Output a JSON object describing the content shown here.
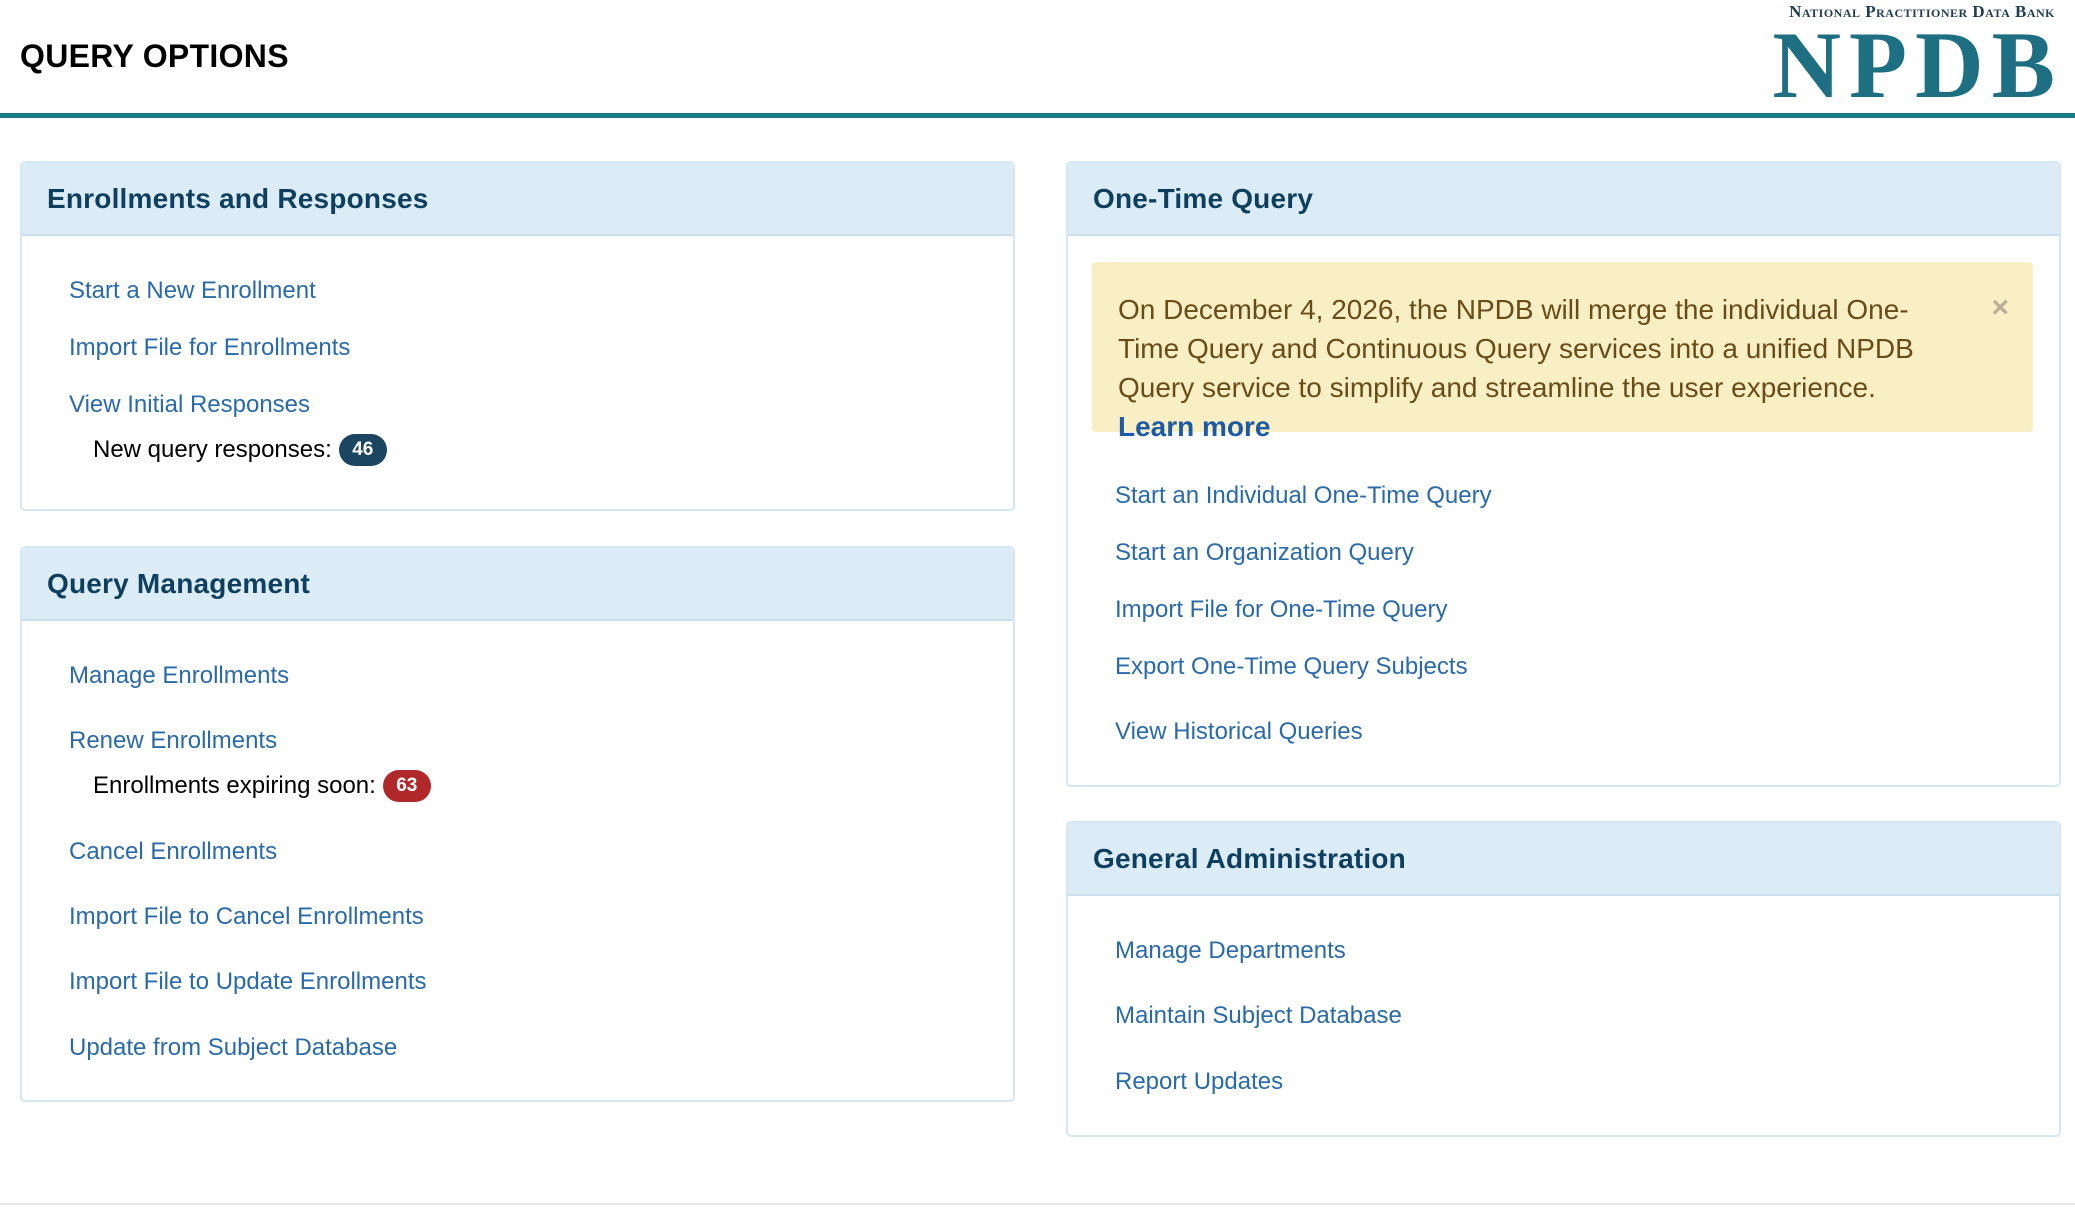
{
  "header": {
    "title": "QUERY OPTIONS",
    "logo_small": "National Practitioner Data Bank",
    "logo_big": "NPDB"
  },
  "enrollments": {
    "title": "Enrollments and Responses",
    "links": [
      "Start a New Enrollment",
      "Import File for Enrollments",
      "View Initial Responses"
    ],
    "new_responses_label": "New query responses:",
    "new_responses_count": "46"
  },
  "query_mgmt": {
    "title": "Query Management",
    "links": [
      "Manage Enrollments",
      "Renew Enrollments",
      "Cancel Enrollments",
      "Import File to Cancel Enrollments",
      "Import File to Update Enrollments",
      "Update from Subject Database"
    ],
    "expiring_label": "Enrollments expiring soon:",
    "expiring_count": "63"
  },
  "one_time": {
    "title": "One-Time Query",
    "alert_text": "On December 4, 2026, the NPDB will merge the individual One-Time Query and Continuous Query services into a unified NPDB Query service to simplify and streamline the user experience.",
    "alert_link": "Learn more",
    "alert_close": "×",
    "links": [
      "Start an Individual One-Time Query",
      "Start an Organization Query",
      "Import File for One-Time Query",
      "Export One-Time Query Subjects",
      "View Historical Queries"
    ]
  },
  "general_admin": {
    "title": "General Administration",
    "links": [
      "Manage Departments",
      "Maintain Subject Database",
      "Report Updates"
    ]
  },
  "colors": {
    "accent": "#1a7b86",
    "panel_header": "#dbecf6",
    "link": "#2a6aa8",
    "badge_blue": "#1b4560",
    "badge_red": "#b0282a",
    "alert_bg": "#f9efc4"
  }
}
